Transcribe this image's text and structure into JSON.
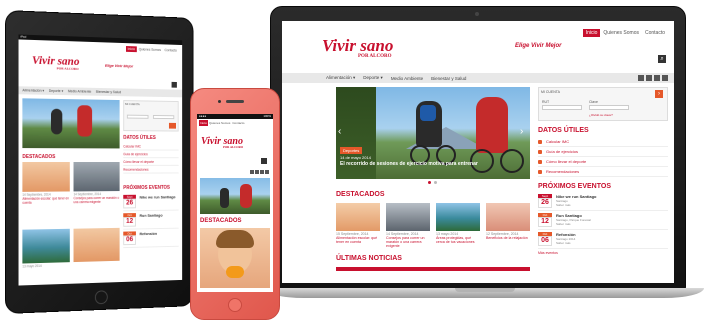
{
  "site": {
    "logo": "Vivir sano",
    "logo_sub": "POR ALCORO",
    "tagline": "Elige Vivir Mejor"
  },
  "laptop": {
    "topnav": [
      "Inicio",
      "Quienes Somos",
      "Contacto"
    ],
    "menu": [
      "Alimentación ▾",
      "Deporte ▾",
      "Medio Ambiente",
      "Bienestar y Salud"
    ],
    "hero": {
      "badge": "Deportes",
      "date": "14 de mayo 2014",
      "caption": "El recorrido de sesiones de ejercicio motiva para entrenar"
    },
    "sections": {
      "destacados": "DESTACADOS",
      "ultimas": "ÚLTIMAS NOTICIAS",
      "datos": "DATOS ÚTILES",
      "eventos": "PRÓXIMOS EVENTOS"
    },
    "cards": [
      {
        "date": "15 Septiembre, 2014",
        "title": "Alimentación escolar: qué tener en cuenta"
      },
      {
        "date": "14 Septiembre, 2014",
        "title": "Consejos para correr un maratón o una carrera exigente"
      },
      {
        "date": "13 mayo 2014",
        "title": "Áreas protegidas, qué cerca de tus vacaciones"
      },
      {
        "date": "12 Septiembre, 2014",
        "title": "Beneficios de la relajación"
      }
    ],
    "login": {
      "title": "MI CUENTA",
      "rut_label": "RUT",
      "clave_label": "Clave",
      "forgot": "¿Olvidó su clave?"
    },
    "datos": [
      "Calcular IMC",
      "Guía de ejercicios",
      "Cómo llevar el deporte",
      "Recomendaciones"
    ],
    "events": [
      {
        "month": "Sept",
        "day": "26",
        "title": "Nike we run Santiago",
        "place": "Santiago",
        "more": "Saber más"
      },
      {
        "month": "Oct",
        "day": "12",
        "title": "Run Santiago",
        "place": "Santiago, Parque Forestal",
        "more": "Saber más"
      },
      {
        "month": "Oct",
        "day": "06",
        "title": "Refonsión",
        "place": "Santiago 2014",
        "more": "Saber más"
      }
    ],
    "more_events": "Más eventos"
  },
  "tablet": {
    "status": "iPad",
    "topnav": [
      "Inicio",
      "Quienes Somos",
      "Contacto"
    ],
    "menu": [
      "Alimentación ▾",
      "Deporte ▾",
      "Medio Ambiente",
      "Bienestar y Salud"
    ],
    "login_title": "MI CUENTA",
    "sections": {
      "destacados": "DESTACADOS",
      "datos": "DATOS ÚTILES",
      "eventos": "PRÓXIMOS EVENTOS"
    },
    "cards": [
      {
        "date": "14 Septiembre, 2014",
        "title": "Alimentación escolar: qué tener en cuenta"
      },
      {
        "date": "14 Septiembre, 2014",
        "title": "Consejos para correr un maratón o una carrera exigente"
      },
      {
        "date": "13 mayo 2014",
        "title": ""
      }
    ],
    "datos": [
      "Calcular IMC",
      "Guía de ejercicios",
      "Cómo llevar el deporte",
      "Recomendaciones"
    ],
    "events": [
      {
        "month": "Sept",
        "day": "26",
        "title": "Nike we run Santiago"
      },
      {
        "month": "Oct",
        "day": "12",
        "title": "Run Santiago"
      },
      {
        "month": "Oct",
        "day": "06",
        "title": "Refonsión"
      }
    ]
  },
  "phone": {
    "status_left": "●●●●",
    "status_right": "100%",
    "topnav": [
      "Inicio",
      "Quienes Somos",
      "Contacto"
    ],
    "section": "DESTACADOS"
  },
  "colors": {
    "brand": "#c8102e",
    "accent": "#e5582a",
    "phone_shell": "#f07468"
  }
}
